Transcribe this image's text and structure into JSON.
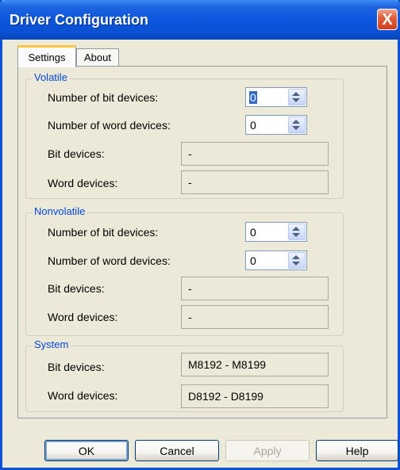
{
  "window": {
    "title": "Driver Configuration",
    "close_symbol": "X"
  },
  "tabs": [
    {
      "label": "Settings",
      "active": true
    },
    {
      "label": "About",
      "active": false
    }
  ],
  "volatile": {
    "legend": "Volatile",
    "num_bit_label": "Number of bit devices:",
    "num_bit_value": "0",
    "num_word_label": "Number of word devices:",
    "num_word_value": "0",
    "bit_devices_label": "Bit devices:",
    "bit_devices_value": "-",
    "word_devices_label": "Word devices:",
    "word_devices_value": "-"
  },
  "nonvolatile": {
    "legend": "Nonvolatile",
    "num_bit_label": "Number of bit devices:",
    "num_bit_value": "0",
    "num_word_label": "Number of word devices:",
    "num_word_value": "0",
    "bit_devices_label": "Bit devices:",
    "bit_devices_value": "-",
    "word_devices_label": "Word devices:",
    "word_devices_value": "-"
  },
  "system": {
    "legend": "System",
    "bit_devices_label": "Bit devices:",
    "bit_devices_value": "M8192 - M8199",
    "word_devices_label": "Word devices:",
    "word_devices_value": "D8192 - D8199"
  },
  "buttons": {
    "ok": "OK",
    "cancel": "Cancel",
    "apply": "Apply",
    "help": "Help"
  },
  "colors": {
    "title_bar": "#0a55dc",
    "close": "#e2603e",
    "legend": "#0046d5",
    "face": "#ece9d8",
    "active_tab_accent": "#ffc83c"
  },
  "icons": {
    "close": "close-icon",
    "spin_up": "spin-up-icon",
    "spin_down": "spin-down-icon"
  }
}
